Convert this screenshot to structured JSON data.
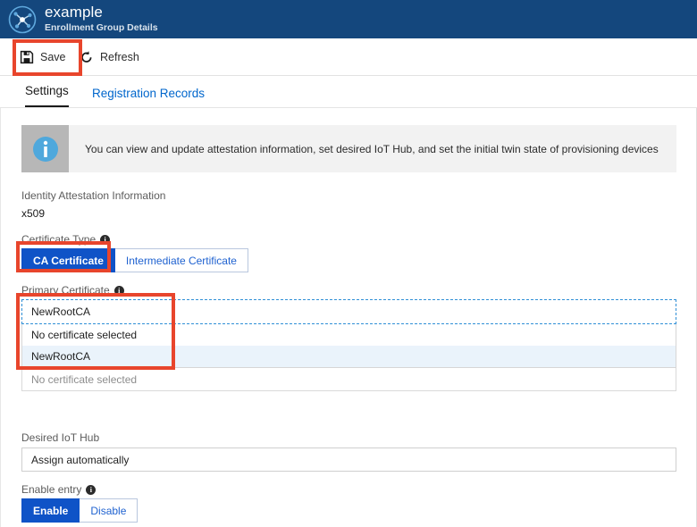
{
  "window": {
    "title": "example",
    "subtitle": "Enrollment Group Details",
    "logo_icon": "iot-hub-icon"
  },
  "commandbar": {
    "save_label": "Save",
    "save_icon": "save-disk-icon",
    "refresh_label": "Refresh",
    "refresh_icon": "refresh-circular-arrow-icon"
  },
  "tabs": [
    {
      "label": "Settings",
      "selected": true
    },
    {
      "label": "Registration Records",
      "selected": false
    }
  ],
  "banner": {
    "icon": "info-circle-icon",
    "text": "You can view and update attestation information, set desired IoT Hub, and set the initial twin state of provisioning devices"
  },
  "attestation": {
    "label": "Identity Attestation Information",
    "value": "x509"
  },
  "certificate_type": {
    "label": "Certificate Type",
    "info_icon": "info-tooltip-icon",
    "options": [
      {
        "label": "CA Certificate",
        "selected": true
      },
      {
        "label": "Intermediate Certificate",
        "selected": false
      }
    ]
  },
  "primary_certificate": {
    "label": "Primary Certificate",
    "info_icon": "info-tooltip-icon",
    "selected_value": "NewRootCA",
    "dropdown_open": true,
    "options": [
      {
        "label": "No certificate selected",
        "highlighted": false
      },
      {
        "label": "NewRootCA",
        "highlighted": true
      }
    ]
  },
  "secondary_certificate": {
    "occluded_label": "No certificate selected"
  },
  "desired_iot_hub": {
    "label": "Desired IoT Hub",
    "value": "Assign automatically"
  },
  "enable_entry": {
    "label": "Enable entry",
    "info_icon": "info-tooltip-icon",
    "options": [
      {
        "label": "Enable",
        "selected": true
      },
      {
        "label": "Disable",
        "selected": false
      }
    ]
  },
  "annotations": {
    "color": "#e8452c",
    "boxes": [
      {
        "name": "save-button-highlight"
      },
      {
        "name": "ca-certificate-toggle-highlight"
      },
      {
        "name": "primary-certificate-dropdown-highlight"
      }
    ]
  },
  "colors": {
    "titlebar": "#14477d",
    "accent_blue": "#0f53c7",
    "link_blue": "#0066cc",
    "annotation_red": "#e8452c"
  }
}
